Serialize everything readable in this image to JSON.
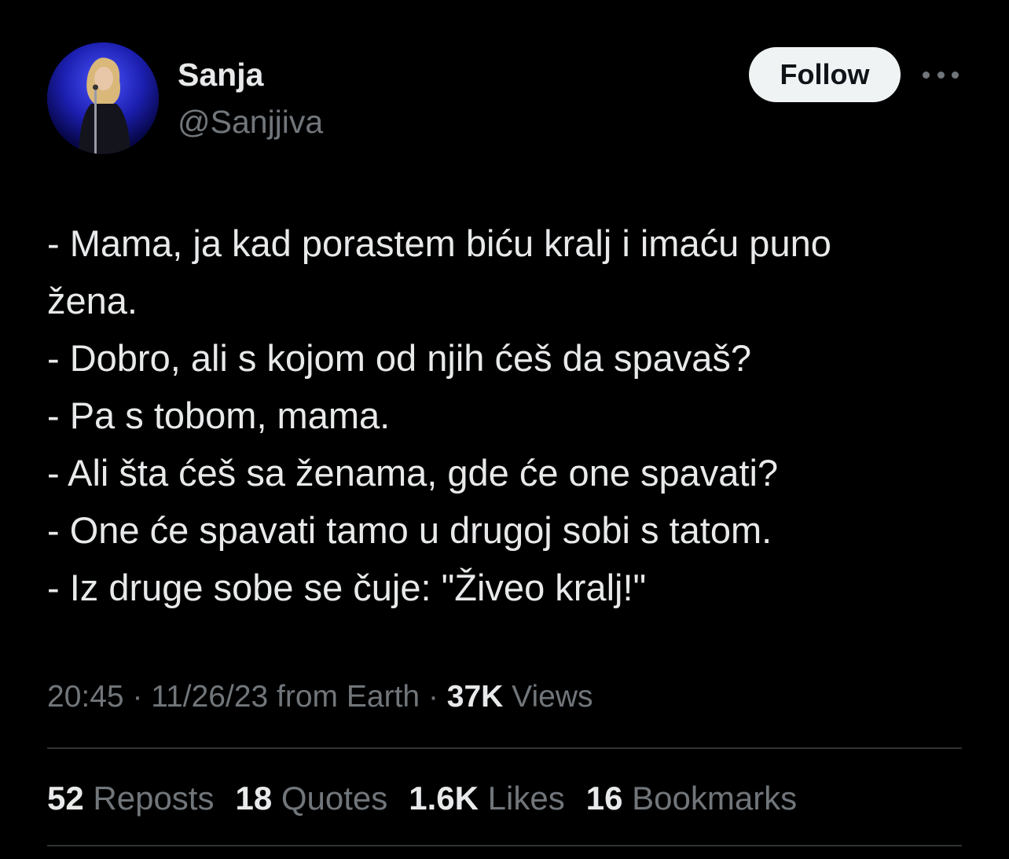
{
  "author": {
    "display_name": "Sanja",
    "handle": "@Sanjjiva"
  },
  "follow_label": "Follow",
  "tweet_lines": [
    "- Mama, ja kad porastem biću kralj i imaću puno",
    "žena.",
    "- Dobro, ali s kojom od njih ćeš da spavaš?",
    "- Pa s tobom, mama.",
    "- Ali šta ćeš sa ženama, gde će one spavati?",
    "- One će spavati tamo u drugoj sobi s tatom.",
    "- Iz druge sobe se čuje: \"Živeo kralj!\""
  ],
  "meta": {
    "time": "20:45",
    "separator": " · ",
    "date": "11/26/23",
    "source": "from Earth",
    "views_count": "37K",
    "views_label": "Views"
  },
  "stats": {
    "reposts_count": "52",
    "reposts_label": "Reposts",
    "quotes_count": "18",
    "quotes_label": "Quotes",
    "likes_count": "1.6K",
    "likes_label": "Likes",
    "bookmarks_count": "16",
    "bookmarks_label": "Bookmarks"
  },
  "colors": {
    "background": "#000000",
    "primary_text": "#e7e9ea",
    "secondary_text": "#71767b",
    "divider": "#2f3336",
    "follow_button_bg": "#eff3f4"
  },
  "icons": {
    "more": "more-horizontal-icon"
  }
}
